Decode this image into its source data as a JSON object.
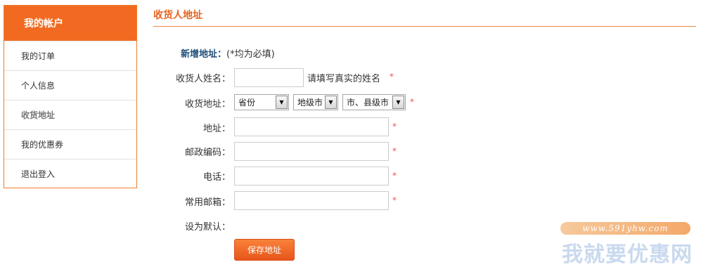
{
  "sidebar": {
    "header": "我的帐户",
    "items": [
      {
        "label": "我的订单"
      },
      {
        "label": "个人信息"
      },
      {
        "label": "收货地址"
      },
      {
        "label": "我的优惠券"
      },
      {
        "label": "退出登入"
      }
    ]
  },
  "main": {
    "title": "收货人地址"
  },
  "form": {
    "new_address_label": "新增地址：",
    "required_hint": "(*均为必填)",
    "name_label": "收货人姓名：",
    "name_hint": "请填写真实的姓名",
    "region_label": "收货地址：",
    "province_select": "省份",
    "city_select": "地级市",
    "county_select": "市、县级市",
    "address_label": "地址：",
    "postcode_label": "邮政编码：",
    "phone_label": "电话：",
    "email_label": "常用邮箱：",
    "default_label": "设为默认：",
    "required_mark": "*",
    "save_button": "保存地址"
  },
  "watermark": {
    "url": "www.591yhw.com",
    "name": "我就要优惠网"
  },
  "colors": {
    "accent": "#f26a21",
    "title": "#e8631c",
    "new_address": "#1f4e79",
    "required": "#ee5555"
  }
}
